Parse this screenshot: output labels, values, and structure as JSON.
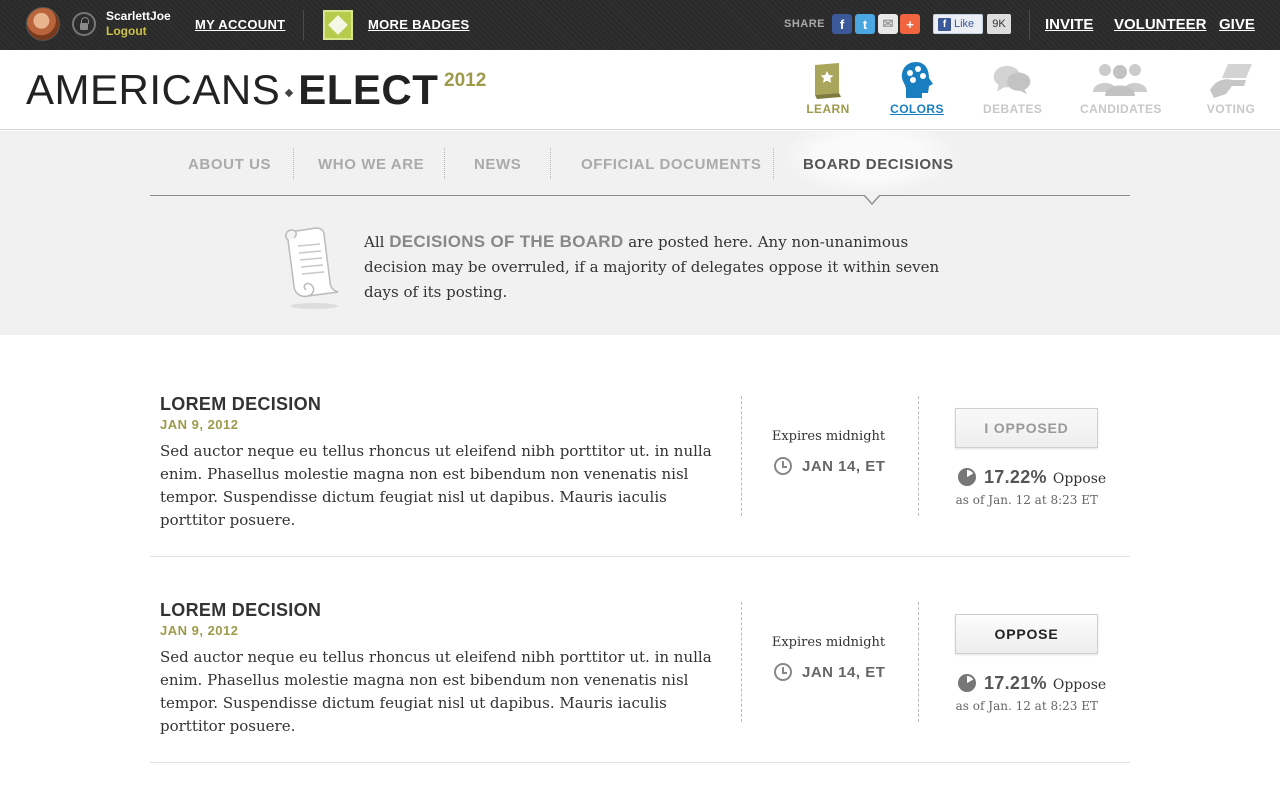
{
  "topbar": {
    "username": "ScarlettJoe",
    "logout": "Logout",
    "my_account": "MY ACCOUNT",
    "more_badges": "MORE BADGES",
    "share_label": "SHARE",
    "fb_like": "Like",
    "fb_count": "9K",
    "invite": "INVITE",
    "volunteer": "VOLUNTEER",
    "give": "GIVE"
  },
  "header": {
    "logo_light": "AMERICANS",
    "logo_bold": "ELECT",
    "logo_year": "2012",
    "nav": [
      {
        "label": "LEARN",
        "icon": "book-icon",
        "color": "#9d9a4a"
      },
      {
        "label": "COLORS",
        "icon": "colors-head-icon",
        "color": "#1a7fc1"
      },
      {
        "label": "DEBATES",
        "icon": "speech-bubbles-icon",
        "color": "#c8c8c8"
      },
      {
        "label": "CANDIDATES",
        "icon": "people-icon",
        "color": "#c8c8c8"
      },
      {
        "label": "VOTING",
        "icon": "hand-ballot-icon",
        "color": "#c8c8c8"
      }
    ]
  },
  "subnav": {
    "tabs": [
      {
        "label": "ABOUT US"
      },
      {
        "label": "WHO WE ARE"
      },
      {
        "label": "NEWS"
      },
      {
        "label": "OFFICIAL DOCUMENTS"
      },
      {
        "label": "BOARD DECISIONS"
      }
    ],
    "active": "BOARD DECISIONS"
  },
  "intro": {
    "prefix": "All",
    "highlight": "DECISIONS OF THE BOARD",
    "text": "are posted here. Any non-unanimous decision may be overruled, if a majority of delegates oppose it within seven days of its posting."
  },
  "decisions": [
    {
      "title": "LOREM DECISION",
      "date": "JAN 9, 2012",
      "body": "Sed auctor neque eu tellus rhoncus ut eleifend nibh porttitor ut. in nulla enim. Phasellus molestie magna non est bibendum non venenatis nisl tempor. Suspendisse dictum feugiat nisl ut dapibus. Mauris iaculis porttitor posuere.",
      "expires_label": "Expires midnight",
      "expires_date": "JAN 14, ET",
      "button": "I OPPOSED",
      "oppose_pct": "17.22%",
      "oppose_label": "Oppose",
      "as_of": "as of Jan. 12 at 8:23 ET"
    },
    {
      "title": "LOREM DECISION",
      "date": "JAN 9, 2012",
      "body": "Sed auctor neque eu tellus rhoncus ut eleifend nibh porttitor ut. in nulla enim. Phasellus molestie magna non est bibendum non venenatis nisl tempor. Suspendisse dictum feugiat nisl ut dapibus. Mauris iaculis porttitor posuere.",
      "expires_label": "Expires midnight",
      "expires_date": "JAN 14, ET",
      "button": "OPPOSE",
      "oppose_pct": "17.21%",
      "oppose_label": "Oppose",
      "as_of": "as of Jan. 12 at 8:23 ET"
    }
  ]
}
